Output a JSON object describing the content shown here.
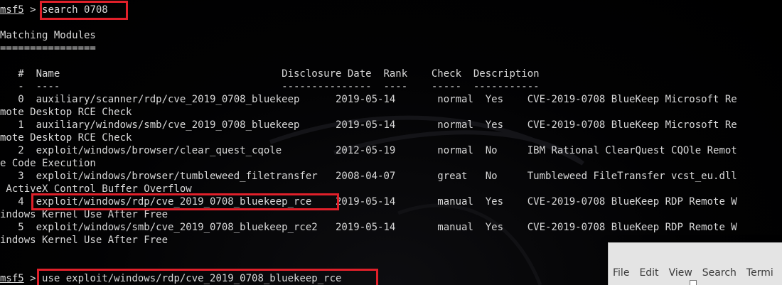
{
  "terminal": {
    "lines": [
      {
        "type": "prompt",
        "name": "msf5",
        "sep": " > ",
        "cmd": "search 0708"
      },
      {
        "type": "blank"
      },
      {
        "type": "text",
        "text": "Matching Modules"
      },
      {
        "type": "text",
        "text": "================"
      },
      {
        "type": "blank"
      },
      {
        "type": "text",
        "text": "   #  Name                                     Disclosure Date  Rank    Check  Description"
      },
      {
        "type": "text",
        "text": "   -  ----                                     ---------------  ----    -----  -----------"
      },
      {
        "type": "text",
        "text": "   0  auxiliary/scanner/rdp/cve_2019_0708_bluekeep      2019-05-14       normal  Yes    CVE-2019-0708 BlueKeep Microsoft Re"
      },
      {
        "type": "text",
        "text": "mote Desktop RCE Check"
      },
      {
        "type": "text",
        "text": "   1  auxiliary/windows/smb/cve_2019_0708_bluekeep      2019-05-14       normal  Yes    CVE-2019-0708 BlueKeep Microsoft Re"
      },
      {
        "type": "text",
        "text": "mote Desktop RCE Check"
      },
      {
        "type": "text",
        "text": "   2  exploit/windows/browser/clear_quest_cqole         2012-05-19       normal  No     IBM Rational ClearQuest CQOle Remot"
      },
      {
        "type": "text",
        "text": "e Code Execution"
      },
      {
        "type": "text",
        "text": "   3  exploit/windows/browser/tumbleweed_filetransfer   2008-04-07       great   No     Tumbleweed FileTransfer vcst_eu.dll"
      },
      {
        "type": "text",
        "text": " ActiveX Control Buffer Overflow"
      },
      {
        "type": "text",
        "text": "   4  exploit/windows/rdp/cve_2019_0708_bluekeep_rce    2019-05-14       manual  Yes    CVE-2019-0708 BlueKeep RDP Remote W"
      },
      {
        "type": "text",
        "text": "indows Kernel Use After Free"
      },
      {
        "type": "text",
        "text": "   5  exploit/windows/smb/cve_2019_0708_bluekeep_rce2   2019-05-14       manual  Yes    CVE-2019-0708 BlueKeep RDP Remote W"
      },
      {
        "type": "text",
        "text": "indows Kernel Use After Free"
      },
      {
        "type": "blank"
      },
      {
        "type": "blank"
      },
      {
        "type": "prompt",
        "name": "msf5",
        "sep": " > ",
        "cmd": "use exploit/windows/rdp/cve_2019_0708_bluekeep_rce"
      }
    ]
  },
  "second_window": {
    "menu": [
      "File",
      "Edit",
      "View",
      "Search",
      "Termi"
    ]
  },
  "colors": {
    "highlight": "#e0202a",
    "text": "#d8d8d8",
    "background": "#000000"
  }
}
